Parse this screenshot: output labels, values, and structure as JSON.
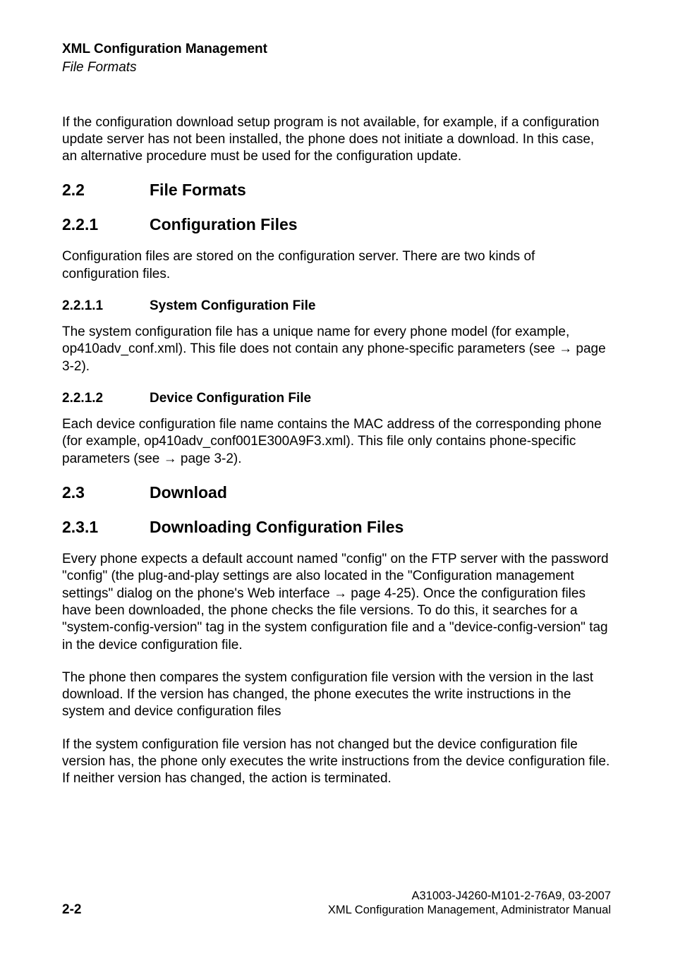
{
  "header": {
    "title": "XML Configuration Management",
    "subtitle": "File Formats"
  },
  "intro": "If the configuration download setup program is not available, for example, if a configuration update server has not been installed, the phone does not initiate a download. In this case, an alternative procedure must be used for the configuration update.",
  "sections": {
    "s22": {
      "num": "2.2",
      "title": "File Formats"
    },
    "s221": {
      "num": "2.2.1",
      "title": "Configuration Files"
    },
    "s221_p": "Configuration files are stored on the configuration server. There are two kinds of configuration files.",
    "s2211": {
      "num": "2.2.1.1",
      "title": "System Configuration File"
    },
    "s2211_p": "The system configuration file has a unique name for every phone model (for example, op410adv_conf.xml). This file does not contain any phone-specific parameters (see → page 3-2).",
    "s2212": {
      "num": "2.2.1.2",
      "title": "Device Configuration File"
    },
    "s2212_p": "Each device configuration file name contains the MAC address of the corresponding phone (for example, op410adv_conf001E300A9F3.xml). This file only contains phone-specific parameters (see → page 3-2).",
    "s23": {
      "num": "2.3",
      "title": "Download"
    },
    "s231": {
      "num": "2.3.1",
      "title": "Downloading Configuration Files"
    },
    "s231_p1": "Every phone expects a default account named \"config\" on the FTP server with the password \"config\" (the plug-and-play settings are also located in the \"Configuration management settings\" dialog on the phone's Web interface → page 4-25). Once the configuration files have been downloaded, the phone checks the file versions. To do this, it searches for a \"system-config-version\" tag in the system configuration file and a \"device-config-version\" tag in the device configuration file.",
    "s231_p2": "The phone then compares the system configuration file version with the version in the last download. If the version has changed, the phone executes the write instructions in the system and device configuration files",
    "s231_p3": "If the system configuration file version has not changed but the device configuration file version has, the phone only executes the write instructions from the device configuration file. If neither version has changed, the action is terminated."
  },
  "footer": {
    "page": "2-2",
    "doc_id": "A31003-J4260-M101-2-76A9, 03-2007",
    "doc_title": "XML Configuration Management, Administrator Manual"
  }
}
